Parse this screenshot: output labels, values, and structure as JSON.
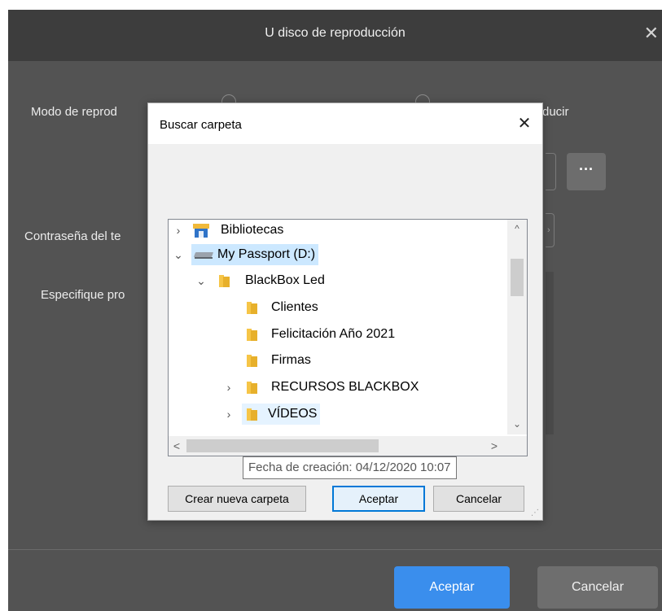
{
  "background_dialog": {
    "title": "U disco de reproducción",
    "mode_label": "Modo de reprod",
    "right_label": "ducir",
    "password_label": "Contraseña del te",
    "specify_label": "Especifique pro",
    "more_button_label": "···",
    "accept_label": "Aceptar",
    "cancel_label": "Cancelar",
    "close_symbol": "✕"
  },
  "folder_dialog": {
    "title": "Buscar carpeta",
    "close_symbol": "✕",
    "tree": [
      {
        "label": "Bibliotecas",
        "icon": "library-icon",
        "chevron": "›"
      },
      {
        "label": "My Passport (D:)",
        "icon": "drive-icon",
        "chevron": "⌄"
      },
      {
        "label": "BlackBox Led",
        "icon": "folder-icon",
        "chevron": "⌄"
      },
      {
        "label": "Clientes",
        "icon": "folder-icon",
        "chevron": ""
      },
      {
        "label": "Felicitación Año 2021",
        "icon": "folder-icon",
        "chevron": ""
      },
      {
        "label": "Firmas",
        "icon": "folder-icon",
        "chevron": ""
      },
      {
        "label": "RECURSOS BLACKBOX",
        "icon": "folder-icon",
        "chevron": "›"
      },
      {
        "label": "VÍDEOS",
        "icon": "folder-icon",
        "chevron": "›"
      }
    ],
    "tooltip": "Fecha de creación: 04/12/2020 10:07",
    "new_folder_label": "Crear nueva carpeta",
    "accept_label": "Aceptar",
    "cancel_label": "Cancelar",
    "scroll_up": "^",
    "scroll_down": "⌄",
    "scroll_left": "<",
    "scroll_right": ">"
  },
  "colors": {
    "accent": "#3a8eed",
    "selection": "#cce8ff",
    "folder": "#f6c547"
  }
}
